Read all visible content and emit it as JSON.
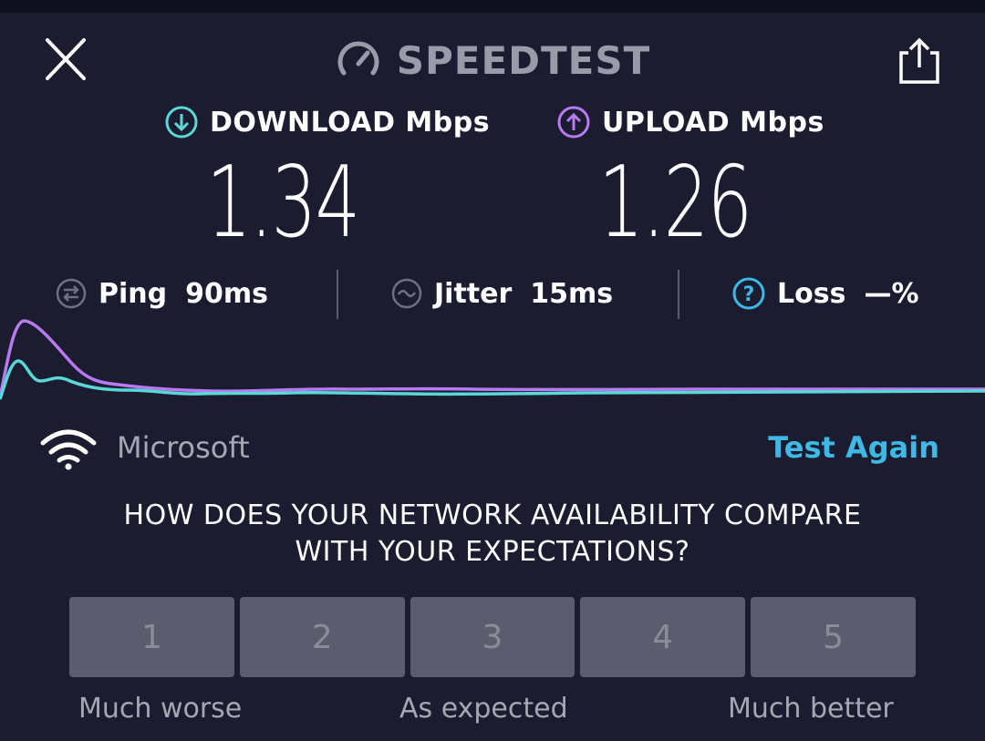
{
  "header": {
    "title": "SPEEDTEST",
    "close_icon": "close-icon",
    "share_icon": "share-icon",
    "brand_icon": "speedometer-icon"
  },
  "download": {
    "label": "DOWNLOAD Mbps",
    "value": "1.34",
    "icon": "download-arrow-icon",
    "color": "#5ad8d8"
  },
  "upload": {
    "label": "UPLOAD Mbps",
    "value": "1.26",
    "icon": "upload-arrow-icon",
    "color": "#b77af0"
  },
  "stats": {
    "ping": {
      "name": "Ping",
      "value": "90ms",
      "icon": "ping-icon"
    },
    "jitter": {
      "name": "Jitter",
      "value": "15ms",
      "icon": "jitter-icon"
    },
    "loss": {
      "name": "Loss",
      "value": "—%",
      "icon": "question-icon",
      "color": "#3fb8e6"
    }
  },
  "network": {
    "name": "Microsoft",
    "icon": "wifi-icon",
    "test_again_label": "Test Again",
    "accent": "#3fb8e6"
  },
  "survey": {
    "question_line1": "HOW DOES YOUR NETWORK AVAILABILITY COMPARE",
    "question_line2": "WITH YOUR EXPECTATIONS?",
    "options": [
      "1",
      "2",
      "3",
      "4",
      "5"
    ],
    "label_low": "Much worse",
    "label_mid": "As expected",
    "label_high": "Much better"
  }
}
